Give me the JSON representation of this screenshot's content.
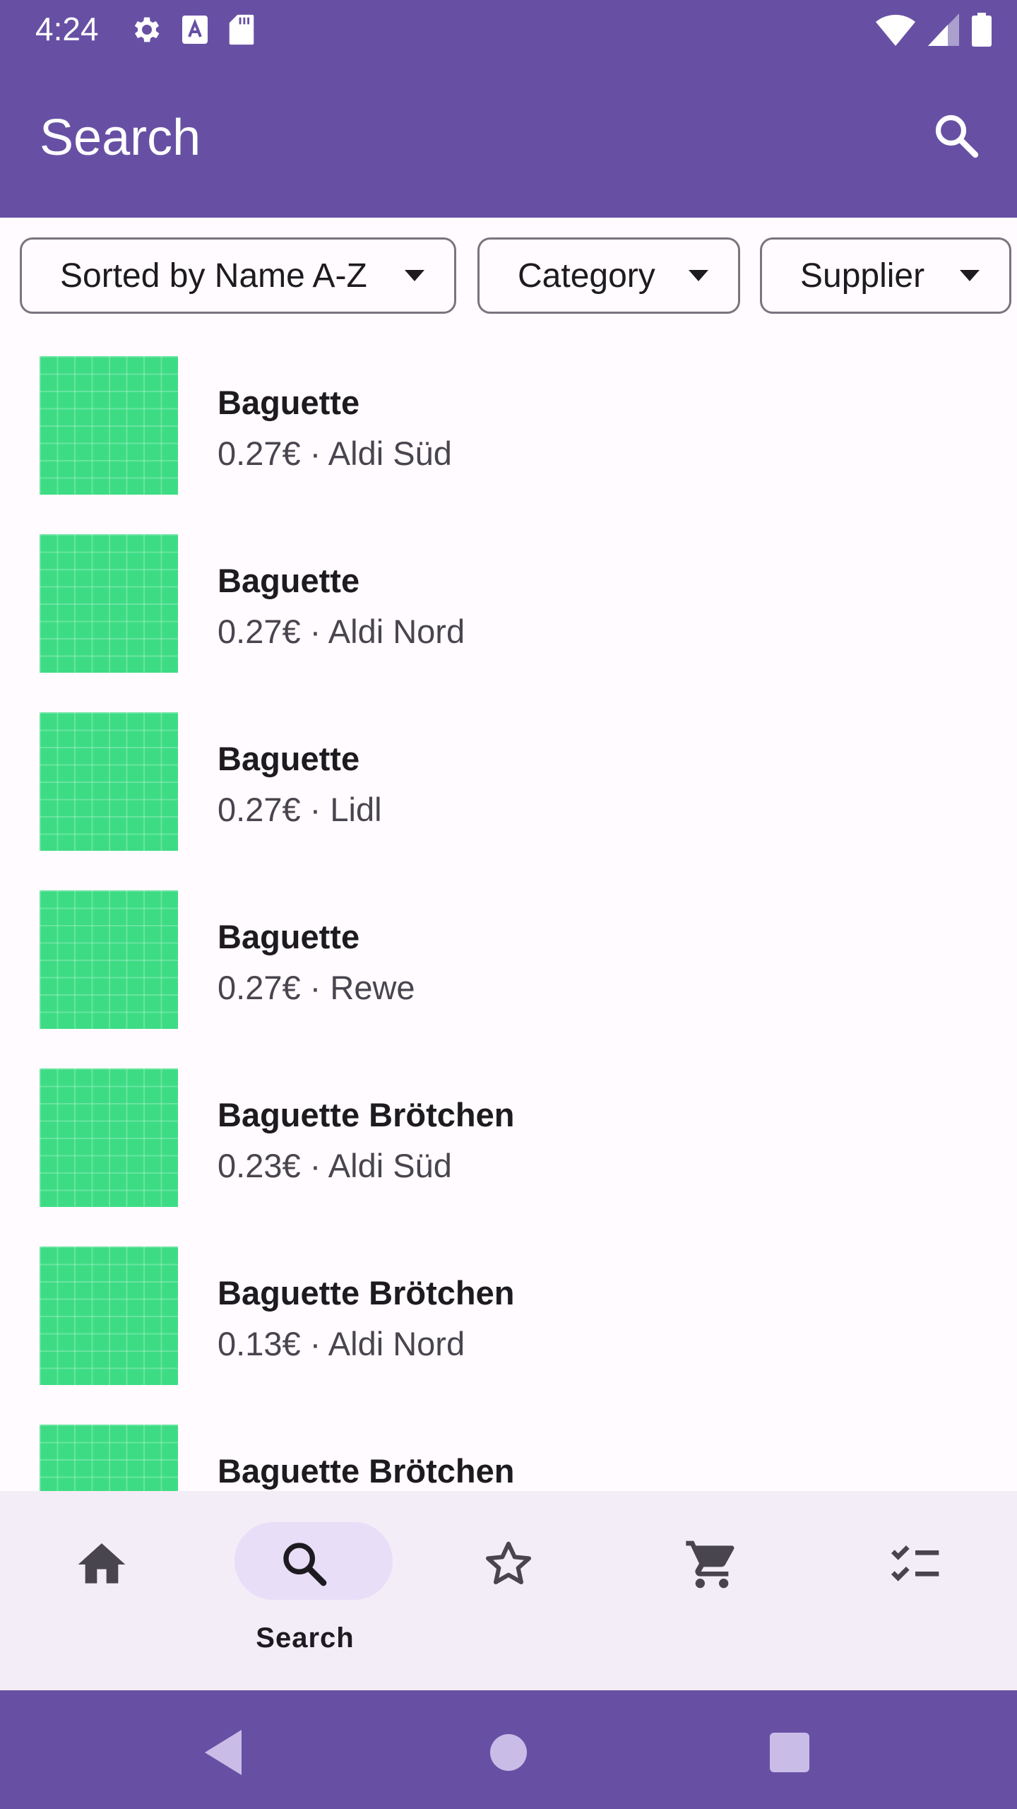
{
  "status_bar": {
    "time": "4:24",
    "left_icons": [
      "gear-icon",
      "font-a-icon",
      "sd-card-icon"
    ],
    "right_icons": [
      "wifi-icon",
      "cell-signal-icon",
      "battery-icon"
    ]
  },
  "app_bar": {
    "title": "Search",
    "action_icon": "search-icon"
  },
  "filters": {
    "sort_label": "Sorted by Name A-Z",
    "category_label": "Category",
    "supplier_label": "Supplier"
  },
  "items": [
    {
      "name": "Baguette",
      "meta": "0.27€ · Aldi Süd"
    },
    {
      "name": "Baguette",
      "meta": "0.27€ · Aldi Nord"
    },
    {
      "name": "Baguette",
      "meta": "0.27€ · Lidl"
    },
    {
      "name": "Baguette",
      "meta": "0.27€ · Rewe"
    },
    {
      "name": "Baguette Brötchen",
      "meta": "0.23€ · Aldi Süd"
    },
    {
      "name": "Baguette Brötchen",
      "meta": "0.13€ · Aldi Nord"
    },
    {
      "name": "Baguette Brötchen",
      "meta": ""
    }
  ],
  "bottom_nav": {
    "items": [
      {
        "icon": "home-icon"
      },
      {
        "icon": "search-icon",
        "label": "Search"
      },
      {
        "icon": "star-icon"
      },
      {
        "icon": "cart-icon"
      },
      {
        "icon": "checklist-icon"
      }
    ],
    "selected_index": 1
  },
  "system_nav": [
    "back-icon",
    "home-circle-icon",
    "recents-square-icon"
  ],
  "colors": {
    "primary": "#6750a4",
    "thumbnail": "#3ddc84",
    "nav_background": "#f3edf7",
    "nav_indicator": "#e8def8"
  }
}
